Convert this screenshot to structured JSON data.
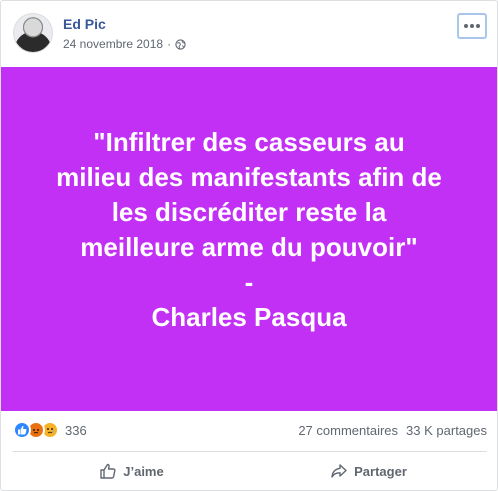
{
  "post": {
    "author": "Ed Pic",
    "date": "24 novembre 2018",
    "separator": "·",
    "privacy_icon": "globe-icon",
    "more_icon": "more-options-icon"
  },
  "quote": {
    "background": "#c22ff5",
    "lines": [
      "\"Infiltrer des casseurs au",
      "milieu des manifestants afin de",
      "les discréditer reste la",
      "meilleure arme du pouvoir\"",
      "-",
      "Charles Pasqua"
    ]
  },
  "stats": {
    "reaction_count": "336",
    "comments": "27 commentaires",
    "shares": "33 K partages",
    "reactions": [
      "like",
      "angry",
      "sad"
    ]
  },
  "actions": {
    "like_label": "J’aime",
    "share_label": "Partager"
  },
  "colors": {
    "author_link": "#385898",
    "meta_text": "#606770",
    "like_blue": "#2d88ff"
  }
}
